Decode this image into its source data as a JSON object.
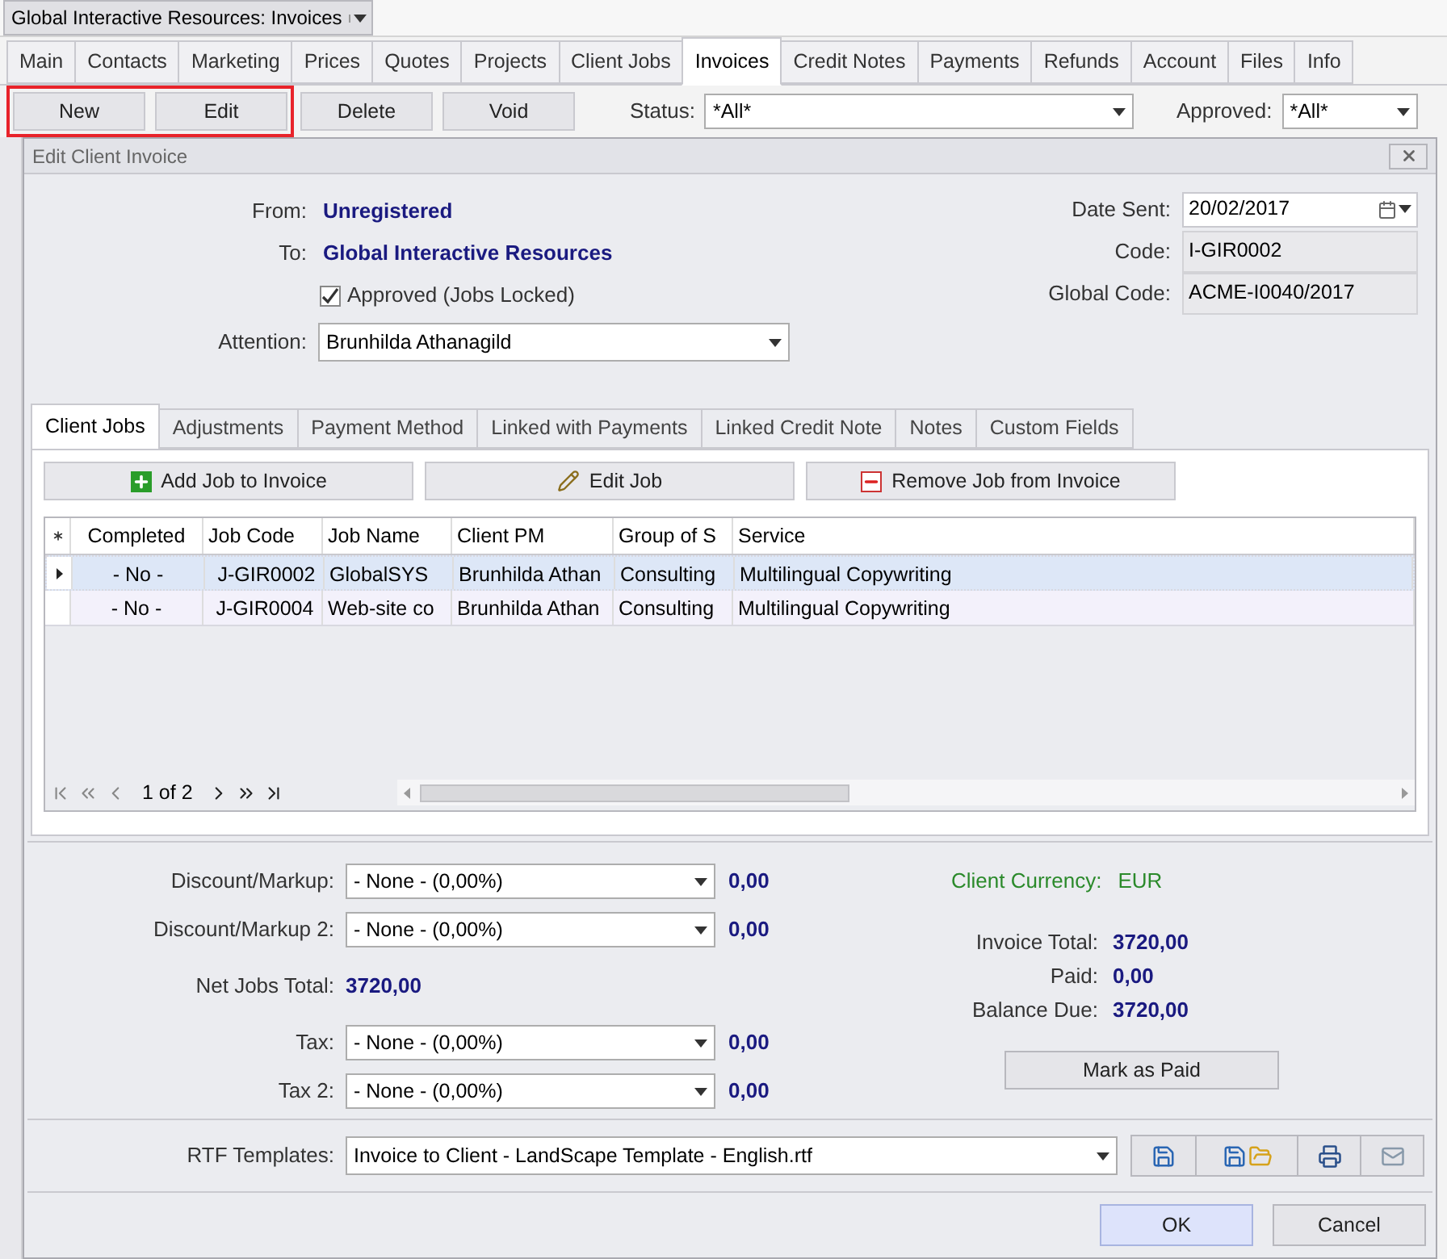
{
  "app_selector": {
    "value": "Global Interactive Resources: Invoices"
  },
  "tabs": [
    {
      "label": "Main",
      "selected": false
    },
    {
      "label": "Contacts",
      "selected": false
    },
    {
      "label": "Marketing",
      "selected": false
    },
    {
      "label": "Prices",
      "selected": false
    },
    {
      "label": "Quotes",
      "selected": false
    },
    {
      "label": "Projects",
      "selected": false
    },
    {
      "label": "Client Jobs",
      "selected": false
    },
    {
      "label": "Invoices",
      "selected": true
    },
    {
      "label": "Credit Notes",
      "selected": false
    },
    {
      "label": "Payments",
      "selected": false
    },
    {
      "label": "Refunds",
      "selected": false
    },
    {
      "label": "Account",
      "selected": false
    },
    {
      "label": "Files",
      "selected": false
    },
    {
      "label": "Info",
      "selected": false
    }
  ],
  "toolbar": {
    "buttons": [
      {
        "label": "New",
        "highlighted": true
      },
      {
        "label": "Edit",
        "highlighted": true
      },
      {
        "label": "Delete",
        "highlighted": false
      },
      {
        "label": "Void",
        "highlighted": false
      }
    ],
    "filters": [
      {
        "label": "Status:",
        "value": "*All*"
      },
      {
        "label": "Approved:",
        "value": "*All*"
      }
    ]
  },
  "dialog": {
    "title": "Edit Client Invoice",
    "from": {
      "label": "From:",
      "value": "Unregistered"
    },
    "to": {
      "label": "To:",
      "value": "Global Interactive Resources"
    },
    "approved": {
      "label": "Approved (Jobs Locked)",
      "checked": true
    },
    "attention": {
      "label": "Attention:",
      "value": "Brunhilda Athanagild"
    },
    "right_fields": [
      {
        "label": "Date Sent:",
        "value": "20/02/2017",
        "kind": "date"
      },
      {
        "label": "Code:",
        "value": "I-GIR0002",
        "kind": "readonly"
      },
      {
        "label": "Global Code:",
        "value": "ACME-I0040/2017",
        "kind": "readonly"
      }
    ],
    "tabs": [
      {
        "label": "Client Jobs",
        "selected": true
      },
      {
        "label": "Adjustments",
        "selected": false
      },
      {
        "label": "Payment Method",
        "selected": false
      },
      {
        "label": "Linked with Payments",
        "selected": false
      },
      {
        "label": "Linked Credit Note",
        "selected": false
      },
      {
        "label": "Notes",
        "selected": false
      },
      {
        "label": "Custom Fields",
        "selected": false
      }
    ],
    "job_buttons": [
      {
        "label": "Add Job to Invoice",
        "kind": "add"
      },
      {
        "label": "Edit Job",
        "kind": "edit"
      },
      {
        "label": "Remove Job from Invoice",
        "kind": "remove"
      }
    ],
    "grid": {
      "columns": [
        "Completed",
        "Job Code",
        "Job Name",
        "Client PM",
        "Group of S",
        "Service"
      ],
      "rows": [
        {
          "selected": true,
          "cells": [
            "- No -",
            "J-GIR0002",
            "GlobalSYS",
            "Brunhilda Athan",
            "Consulting",
            "Multilingual Copywriting"
          ]
        },
        {
          "selected": false,
          "cells": [
            "- No -",
            "J-GIR0004",
            "Web-site co",
            "Brunhilda Athan",
            "Consulting",
            "Multilingual Copywriting"
          ]
        }
      ],
      "pager": "1 of 2"
    },
    "adjustments": [
      {
        "kind": "select",
        "label": "Discount/Markup:",
        "value": "- None - (0,00%)",
        "amount": "0,00"
      },
      {
        "kind": "select",
        "label": "Discount/Markup 2:",
        "value": "- None - (0,00%)",
        "amount": "0,00"
      },
      {
        "kind": "total",
        "label": "Net Jobs Total:",
        "amount": "3720,00"
      },
      {
        "kind": "select",
        "label": "Tax:",
        "value": "- None - (0,00%)",
        "amount": "0,00"
      },
      {
        "kind": "select",
        "label": "Tax 2:",
        "value": "- None - (0,00%)",
        "amount": "0,00"
      }
    ],
    "currency": {
      "label": "Client Currency:",
      "value": "EUR"
    },
    "totals": [
      {
        "label": "Invoice Total:",
        "value": "3720,00"
      },
      {
        "label": "Paid:",
        "value": "0,00"
      },
      {
        "label": "Balance Due:",
        "value": "3720,00"
      }
    ],
    "mark_paid_button": "Mark as Paid",
    "rtf": {
      "label": "RTF Templates:",
      "value": "Invoice to Client - LandScape Template - English.rtf"
    },
    "footer_buttons": [
      {
        "label": "OK",
        "default": true
      },
      {
        "label": "Cancel",
        "default": false
      }
    ]
  }
}
